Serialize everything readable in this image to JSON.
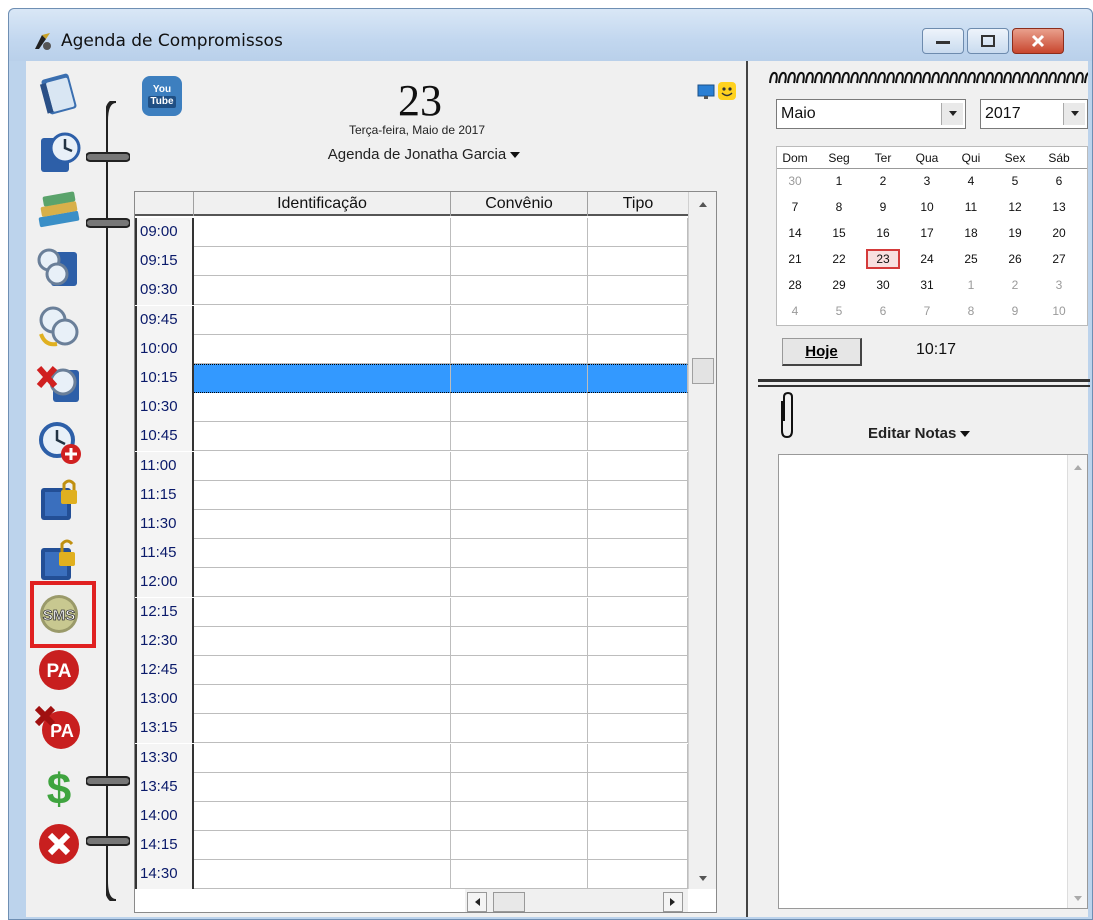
{
  "window": {
    "title": "Agenda de Compromissos"
  },
  "toolbar": {
    "items": [
      {
        "name": "address-book-icon"
      },
      {
        "name": "clock-book-icon"
      },
      {
        "name": "books-icon"
      },
      {
        "name": "clock-group-icon"
      },
      {
        "name": "clock-refresh-icon"
      },
      {
        "name": "clock-delete-icon"
      },
      {
        "name": "clock-add-icon"
      },
      {
        "name": "book-lock-icon"
      },
      {
        "name": "book-unlock-icon"
      },
      {
        "name": "sms-icon",
        "label": "SMS"
      },
      {
        "name": "pa-icon",
        "label": "PA"
      },
      {
        "name": "pa-cancel-icon",
        "label": "PA"
      },
      {
        "name": "dollar-icon",
        "label": "$"
      },
      {
        "name": "close-app-icon"
      }
    ]
  },
  "header": {
    "youtube_top": "You",
    "youtube_bottom": "Tube",
    "day": "23",
    "date_line": "Terça-feira, Maio de 2017",
    "agenda_owner": "Agenda de Jonatha Garcia"
  },
  "grid": {
    "columns": [
      "Identificação",
      "Convênio",
      "Tipo"
    ],
    "times": [
      "09:00",
      "09:15",
      "09:30",
      "09:45",
      "10:00",
      "10:15",
      "10:30",
      "10:45",
      "11:00",
      "11:15",
      "11:30",
      "11:45",
      "12:00",
      "12:15",
      "12:30",
      "12:45",
      "13:00",
      "13:15",
      "13:30",
      "13:45",
      "14:00",
      "14:15",
      "14:30"
    ],
    "selected_time": "10:15"
  },
  "calendar": {
    "month": "Maio",
    "year": "2017",
    "weekdays": [
      "Dom",
      "Seg",
      "Ter",
      "Qua",
      "Qui",
      "Sex",
      "Sáb"
    ],
    "weeks": [
      [
        "30",
        "1",
        "2",
        "3",
        "4",
        "5",
        "6"
      ],
      [
        "7",
        "8",
        "9",
        "10",
        "11",
        "12",
        "13"
      ],
      [
        "14",
        "15",
        "16",
        "17",
        "18",
        "19",
        "20"
      ],
      [
        "21",
        "22",
        "23",
        "24",
        "25",
        "26",
        "27"
      ],
      [
        "28",
        "29",
        "30",
        "31",
        "1",
        "2",
        "3"
      ],
      [
        "4",
        "5",
        "6",
        "7",
        "8",
        "9",
        "10"
      ]
    ],
    "today": "23",
    "hoje_label": "Hoje",
    "time": "10:17"
  },
  "notes": {
    "title": "Editar Notas"
  },
  "colors": {
    "selection": "#3399ff",
    "highlight_box": "#e02020",
    "today_border": "#d43a3a"
  }
}
